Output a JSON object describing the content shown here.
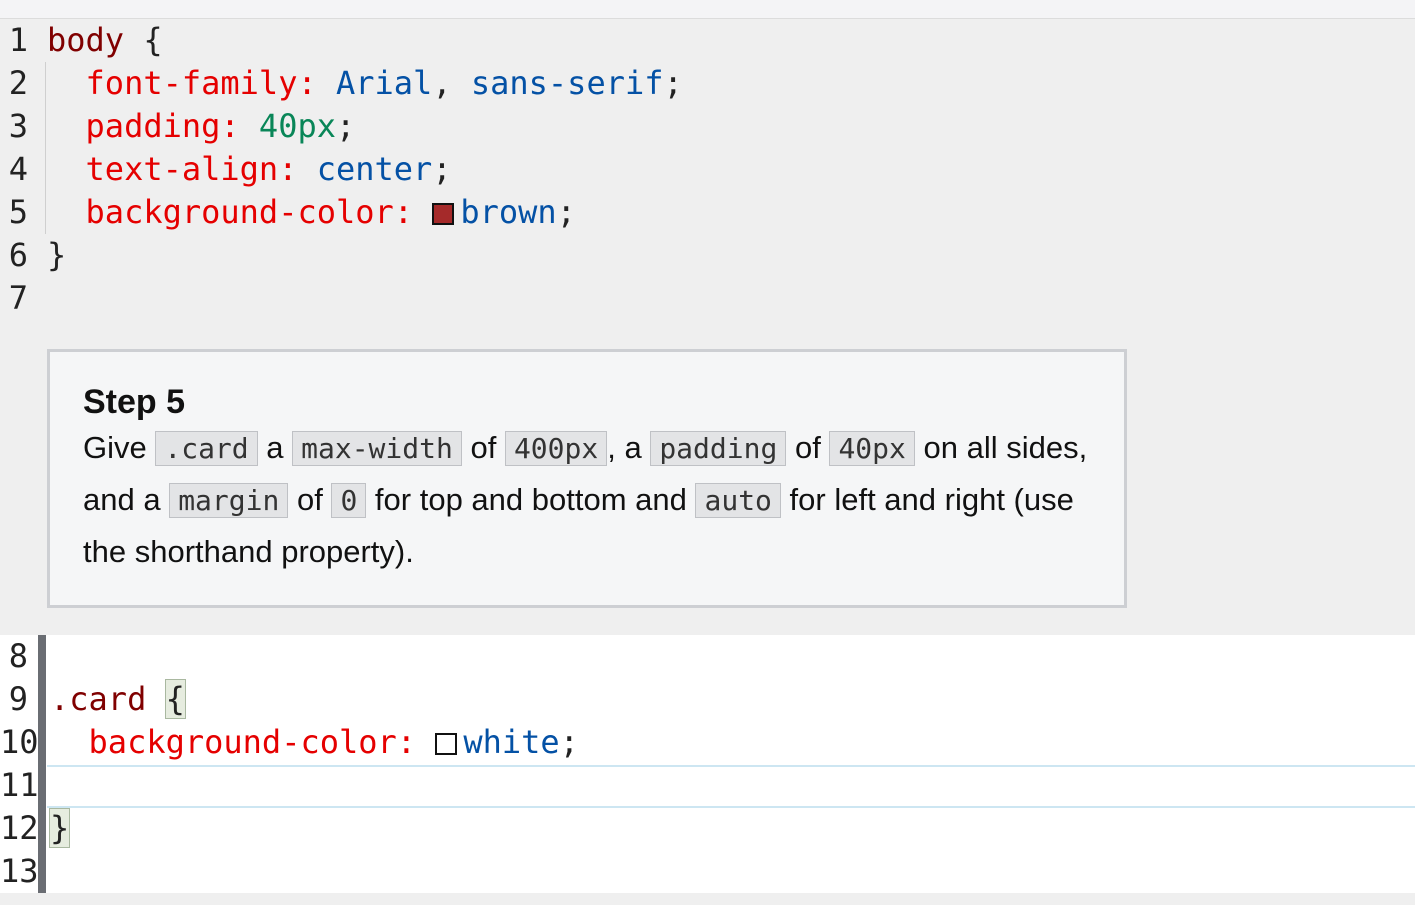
{
  "top_code": [
    {
      "n": "1",
      "tokens": [
        {
          "t": "body",
          "c": "sel"
        },
        {
          "t": " {",
          "c": "punc"
        }
      ]
    },
    {
      "n": "2",
      "tokens": [
        {
          "t": "  ",
          "c": "punc"
        },
        {
          "t": "font-family:",
          "c": "prop"
        },
        {
          "t": " ",
          "c": "punc"
        },
        {
          "t": "Arial",
          "c": "kw"
        },
        {
          "t": ", ",
          "c": "punc"
        },
        {
          "t": "sans-serif",
          "c": "kw"
        },
        {
          "t": ";",
          "c": "punc"
        }
      ]
    },
    {
      "n": "3",
      "tokens": [
        {
          "t": "  ",
          "c": "punc"
        },
        {
          "t": "padding:",
          "c": "prop"
        },
        {
          "t": " ",
          "c": "punc"
        },
        {
          "t": "40px",
          "c": "num"
        },
        {
          "t": ";",
          "c": "punc"
        }
      ]
    },
    {
      "n": "4",
      "tokens": [
        {
          "t": "  ",
          "c": "punc"
        },
        {
          "t": "text-align:",
          "c": "prop"
        },
        {
          "t": " ",
          "c": "punc"
        },
        {
          "t": "center",
          "c": "kw"
        },
        {
          "t": ";",
          "c": "punc"
        }
      ]
    },
    {
      "n": "5",
      "tokens": [
        {
          "t": "  ",
          "c": "punc"
        },
        {
          "t": "background-color:",
          "c": "prop"
        },
        {
          "t": " ",
          "c": "punc"
        },
        {
          "swatch": "#a52a2a"
        },
        {
          "t": "brown",
          "c": "kw"
        },
        {
          "t": ";",
          "c": "punc"
        }
      ]
    },
    {
      "n": "6",
      "tokens": [
        {
          "t": "}",
          "c": "punc"
        }
      ]
    },
    {
      "n": "7",
      "tokens": []
    }
  ],
  "step": {
    "title": "Step 5",
    "parts": [
      {
        "t": "Give "
      },
      {
        "code": ".card"
      },
      {
        "t": " a "
      },
      {
        "code": "max-width"
      },
      {
        "t": " of "
      },
      {
        "code": "400px"
      },
      {
        "t": ", a "
      },
      {
        "code": "padding"
      },
      {
        "t": " of "
      },
      {
        "code": "40px"
      },
      {
        "t": " on all sides, and a "
      },
      {
        "code": "margin"
      },
      {
        "t": " of "
      },
      {
        "code": "0"
      },
      {
        "t": " for top and bottom and "
      },
      {
        "code": "auto"
      },
      {
        "t": " for left and right (use the shorthand property)."
      }
    ]
  },
  "editor_code": [
    {
      "n": "8",
      "tokens": []
    },
    {
      "n": "9",
      "tokens": [
        {
          "t": ".card",
          "c": "sel"
        },
        {
          "t": " ",
          "c": "punc"
        },
        {
          "t": "{",
          "c": "punc",
          "match": true
        }
      ]
    },
    {
      "n": "10",
      "tokens": [
        {
          "t": "  ",
          "c": "punc"
        },
        {
          "t": "background-color:",
          "c": "prop"
        },
        {
          "t": " ",
          "c": "punc"
        },
        {
          "swatch": "#ffffff"
        },
        {
          "t": "white",
          "c": "kw"
        },
        {
          "t": ";",
          "c": "punc"
        }
      ]
    },
    {
      "n": "11",
      "tokens": []
    },
    {
      "n": "12",
      "tokens": [
        {
          "t": "}",
          "c": "punc",
          "match": true
        }
      ]
    },
    {
      "n": "13",
      "tokens": []
    }
  ]
}
